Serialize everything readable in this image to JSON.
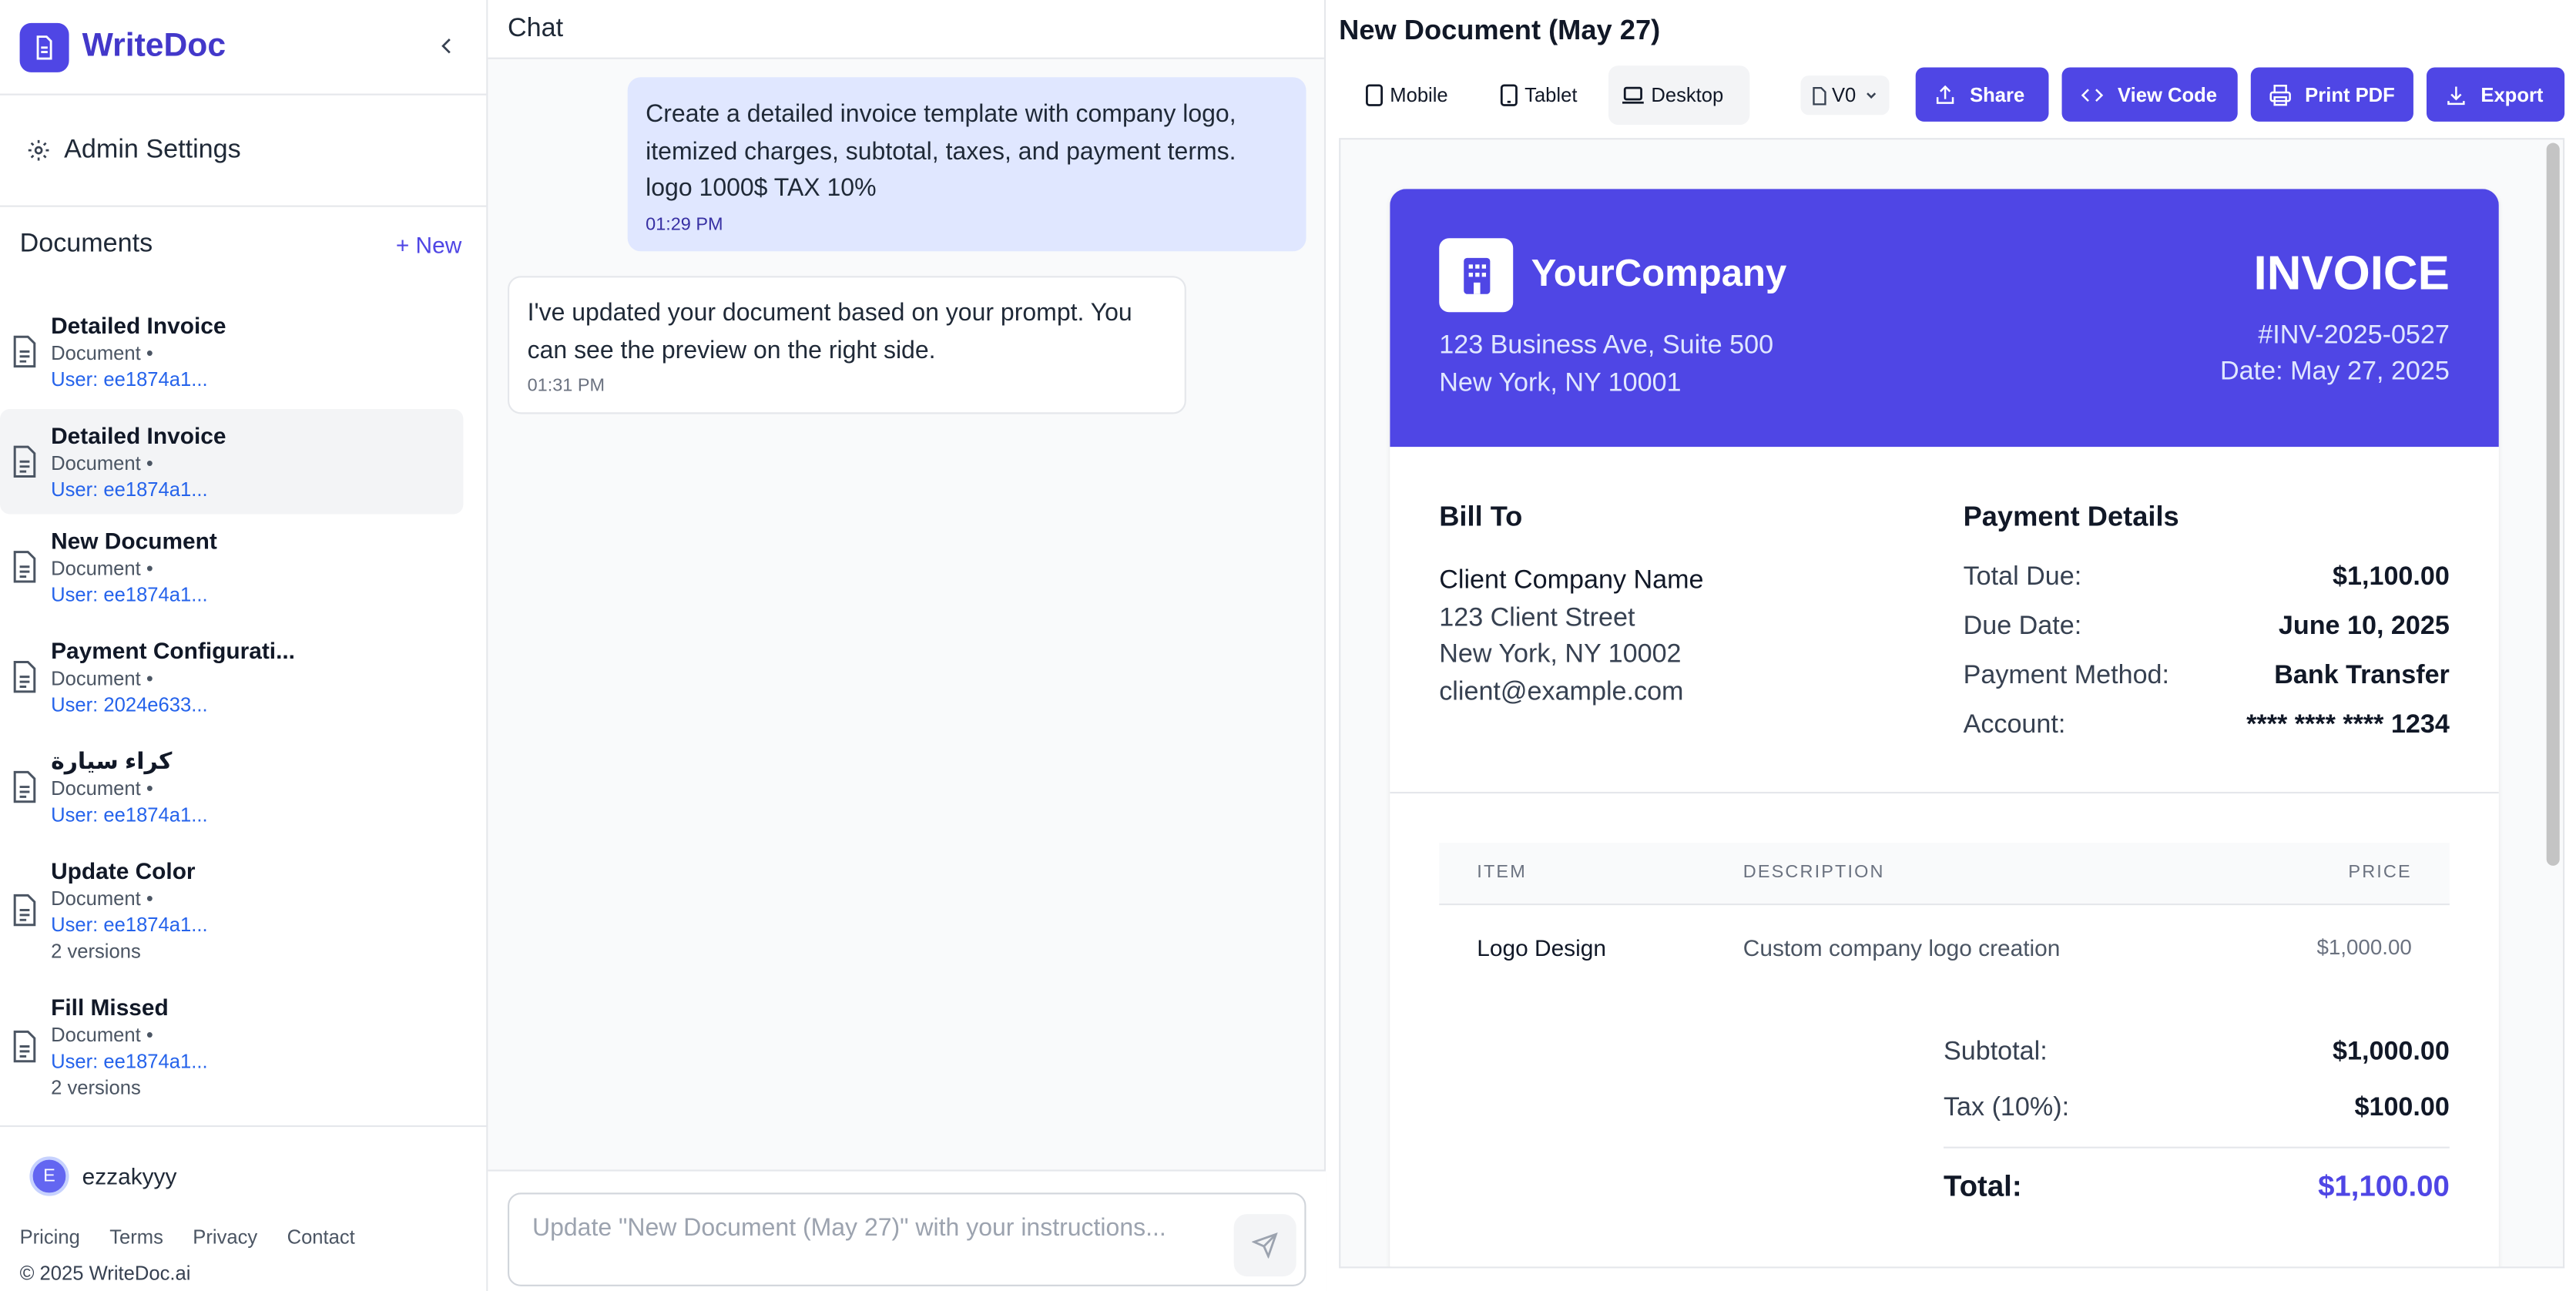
{
  "sidebar": {
    "brand": "WriteDoc",
    "admin_label": "Admin Settings",
    "documents_label": "Documents",
    "new_label": "+ New",
    "docs": [
      {
        "title": "Detailed Invoice",
        "meta": "Document •",
        "user": "User: ee1874a1...",
        "versions": ""
      },
      {
        "title": "Detailed Invoice",
        "meta": "Document •",
        "user": "User: ee1874a1...",
        "versions": ""
      },
      {
        "title": "New Document",
        "meta": "Document •",
        "user": "User: ee1874a1...",
        "versions": ""
      },
      {
        "title": "Payment Configurati...",
        "meta": "Document •",
        "user": "User: 2024e633...",
        "versions": ""
      },
      {
        "title": "كراء سيارة",
        "meta": "Document •",
        "user": "User: ee1874a1...",
        "versions": ""
      },
      {
        "title": "Update Color",
        "meta": "Document •",
        "user": "User: ee1874a1...",
        "versions": "2 versions"
      },
      {
        "title": "Fill Missed",
        "meta": "Document •",
        "user": "User: ee1874a1...",
        "versions": "2 versions"
      }
    ],
    "user": {
      "initial": "E",
      "name": "ezzakyyy"
    },
    "links": [
      "Pricing",
      "Terms",
      "Privacy",
      "Contact"
    ],
    "copyright": "© 2025 WriteDoc.ai"
  },
  "chat": {
    "title": "Chat",
    "messages": [
      {
        "text": "Create a detailed invoice template with company logo, itemized charges, subtotal, taxes, and payment terms. logo 1000$ TAX 10%",
        "time": "01:29 PM"
      },
      {
        "text": "I've updated your document based on your prompt. You can see the preview on the right side.",
        "time": "01:31 PM"
      }
    ],
    "input_placeholder": "Update \"New Document (May 27)\" with your instructions..."
  },
  "preview": {
    "title": "New Document (May 27)",
    "devices": [
      "Mobile",
      "Tablet",
      "Desktop"
    ],
    "version": "V0",
    "actions": [
      "Share",
      "View Code",
      "Print PDF",
      "Export"
    ]
  },
  "invoice": {
    "company": "YourCompany",
    "address1": "123 Business Ave, Suite 500",
    "address2": "New York, NY 10001",
    "heading": "INVOICE",
    "number": "#INV-2025-0527",
    "date": "Date: May 27, 2025",
    "bill_to_label": "Bill To",
    "client_name": "Client Company Name",
    "client_street": "123 Client Street",
    "client_city": "New York, NY 10002",
    "client_email": "client@example.com",
    "payment_label": "Payment Details",
    "payment_rows": [
      {
        "k": "Total Due:",
        "v": "$1,100.00"
      },
      {
        "k": "Due Date:",
        "v": "June 10, 2025"
      },
      {
        "k": "Payment Method:",
        "v": "Bank Transfer"
      },
      {
        "k": "Account:",
        "v": "**** **** **** 1234"
      }
    ],
    "table_headers": [
      "ITEM",
      "DESCRIPTION",
      "PRICE"
    ],
    "items": [
      {
        "item": "Logo Design",
        "description": "Custom company logo creation",
        "price": "$1,000.00"
      }
    ],
    "subtotal_label": "Subtotal:",
    "subtotal": "$1,000.00",
    "tax_label": "Tax (10%):",
    "tax": "$100.00",
    "total_label": "Total:",
    "total": "$1,100.00"
  },
  "colors": {
    "accent": "#4f46e5",
    "link": "#2563eb"
  }
}
